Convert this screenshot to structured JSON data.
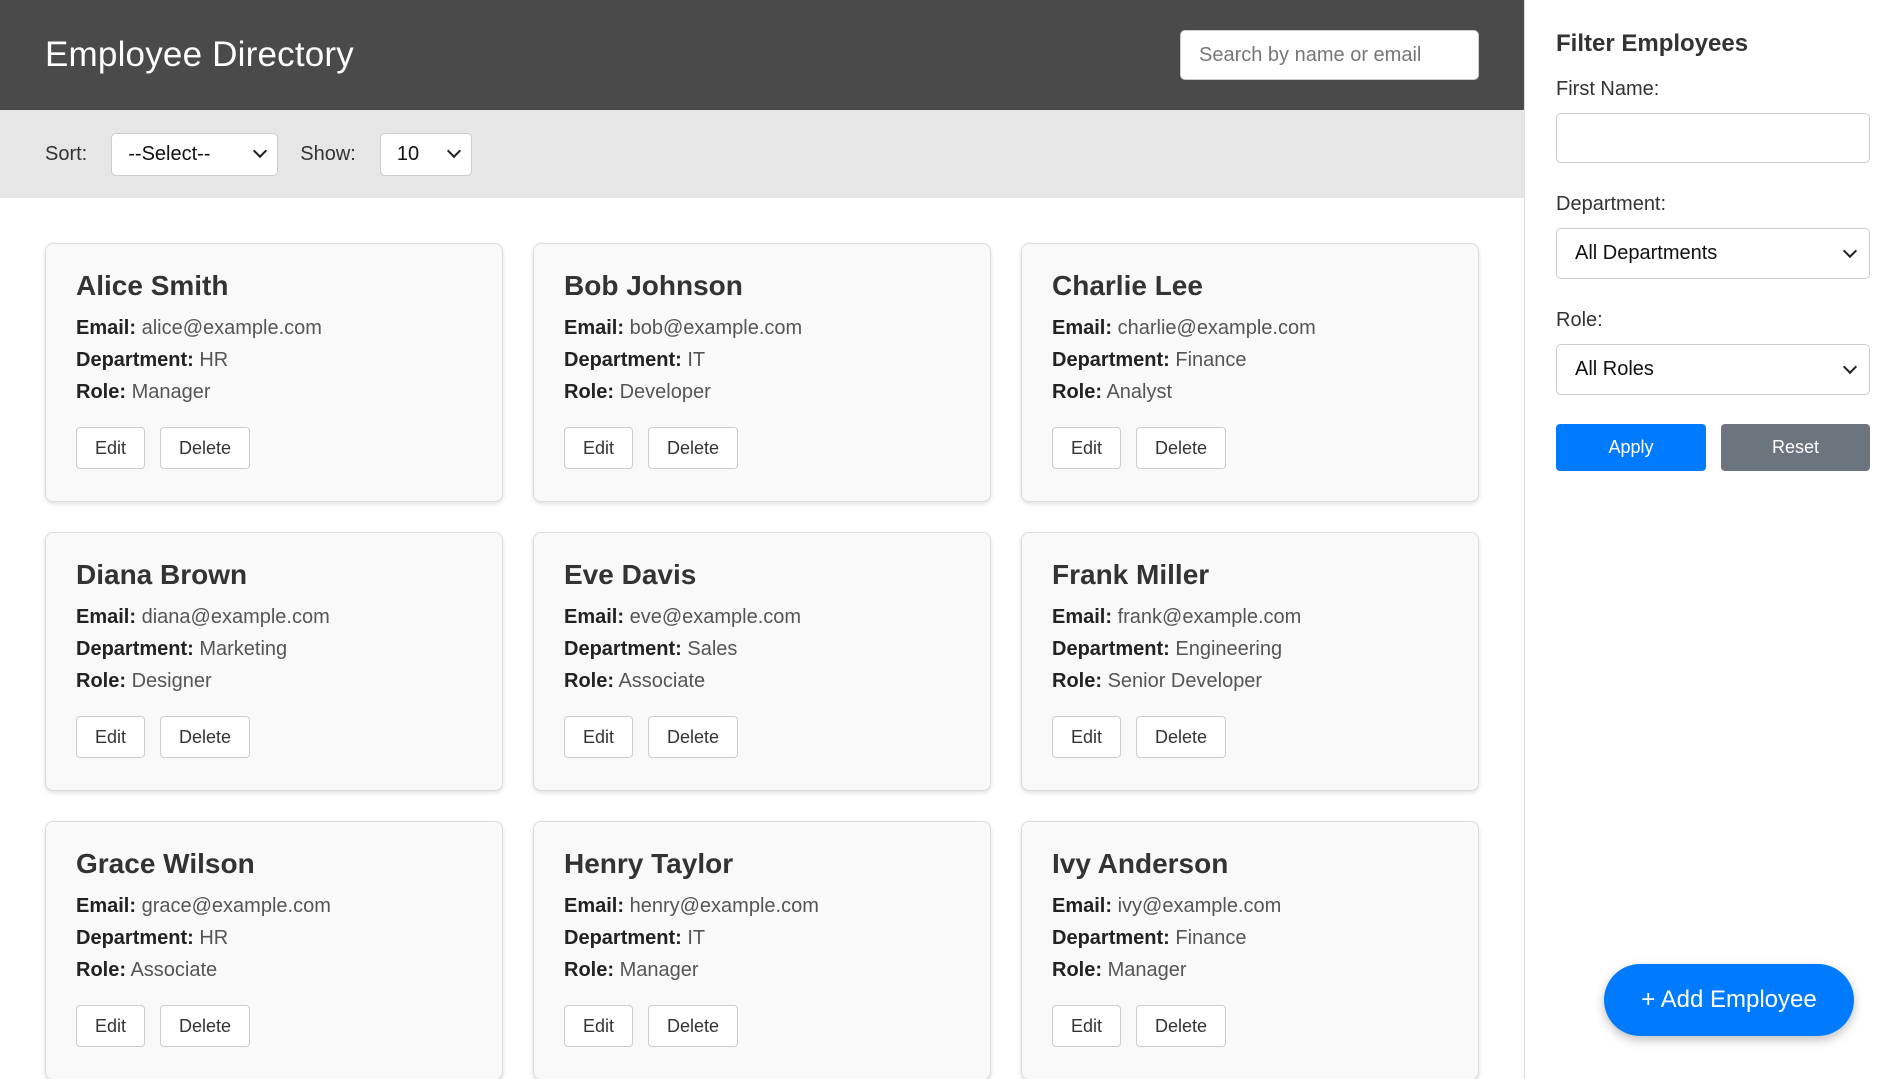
{
  "header": {
    "title": "Employee Directory",
    "search_placeholder": "Search by name or email"
  },
  "toolbar": {
    "sort_label": "Sort:",
    "sort_value": "--Select--",
    "show_label": "Show:",
    "show_value": "10"
  },
  "field_labels": {
    "email": "Email:",
    "department": "Department:",
    "role": "Role:"
  },
  "card_actions": {
    "edit": "Edit",
    "delete": "Delete"
  },
  "employees": [
    {
      "name": "Alice Smith",
      "email": "alice@example.com",
      "department": "HR",
      "role": "Manager"
    },
    {
      "name": "Bob Johnson",
      "email": "bob@example.com",
      "department": "IT",
      "role": "Developer"
    },
    {
      "name": "Charlie Lee",
      "email": "charlie@example.com",
      "department": "Finance",
      "role": "Analyst"
    },
    {
      "name": "Diana Brown",
      "email": "diana@example.com",
      "department": "Marketing",
      "role": "Designer"
    },
    {
      "name": "Eve Davis",
      "email": "eve@example.com",
      "department": "Sales",
      "role": "Associate"
    },
    {
      "name": "Frank Miller",
      "email": "frank@example.com",
      "department": "Engineering",
      "role": "Senior Developer"
    },
    {
      "name": "Grace Wilson",
      "email": "grace@example.com",
      "department": "HR",
      "role": "Associate"
    },
    {
      "name": "Henry Taylor",
      "email": "henry@example.com",
      "department": "IT",
      "role": "Manager"
    },
    {
      "name": "Ivy Anderson",
      "email": "ivy@example.com",
      "department": "Finance",
      "role": "Manager"
    }
  ],
  "sidebar": {
    "title": "Filter Employees",
    "first_name_label": "First Name:",
    "first_name_value": "",
    "department_label": "Department:",
    "department_value": "All Departments",
    "role_label": "Role:",
    "role_value": "All Roles",
    "apply_label": "Apply",
    "reset_label": "Reset"
  },
  "fab": {
    "label": "+ Add Employee"
  },
  "colors": {
    "header_bg": "#4a4a4a",
    "toolbar_bg": "#e6e6e6",
    "primary": "#007bff",
    "secondary": "#6c757d"
  },
  "icons": {
    "select_arrow": "chevron-down-icon"
  }
}
